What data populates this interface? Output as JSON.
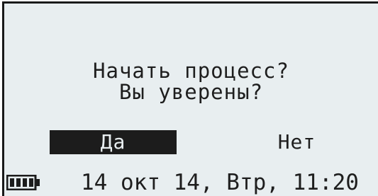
{
  "dialog": {
    "line1": "Начать процесс?",
    "line2": "Вы уверены?"
  },
  "buttons": {
    "yes_label": "Да",
    "no_label": "Нет",
    "selected": "yes"
  },
  "status_bar": {
    "battery_icon": "battery-full-icon",
    "battery_level": 1.0,
    "datetime": "14 окт 14, Втр, 11:20"
  },
  "colors": {
    "screen_bg": "#e8eef0",
    "foreground": "#1c1c1c"
  }
}
